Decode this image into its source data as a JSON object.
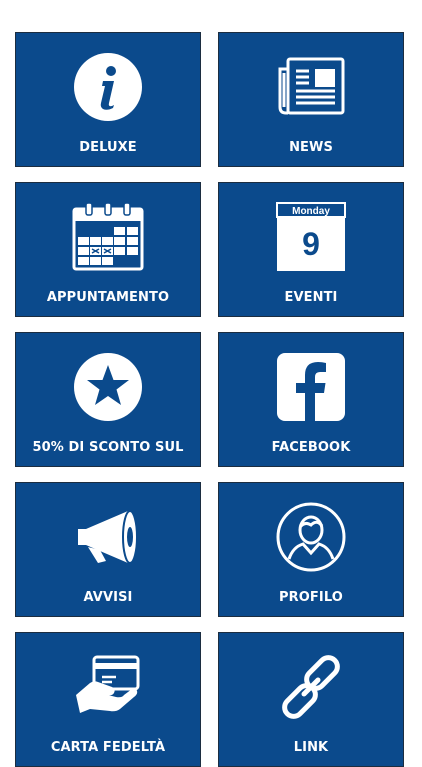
{
  "colors": {
    "tile_background": "#0b4a8c",
    "tile_border": "#1c2d40",
    "icon_foreground": "#ffffff"
  },
  "tiles": [
    {
      "label": "DELUXE",
      "icon": "info-icon"
    },
    {
      "label": "NEWS",
      "icon": "newspaper-icon"
    },
    {
      "label": "APPUNTAMENTO",
      "icon": "calendar-grid-icon"
    },
    {
      "label": "EVENTI",
      "icon": "calendar-day-icon",
      "icon_month": "Monday",
      "icon_day": "9"
    },
    {
      "label": "50% DI SCONTO SUL",
      "icon": "star-icon"
    },
    {
      "label": "FACEBOOK",
      "icon": "facebook-icon"
    },
    {
      "label": "AVVISI",
      "icon": "megaphone-icon"
    },
    {
      "label": "PROFILO",
      "icon": "user-profile-icon"
    },
    {
      "label": "CARTA FEDELTÀ",
      "icon": "loyalty-card-icon"
    },
    {
      "label": "LINK",
      "icon": "chain-link-icon"
    }
  ]
}
